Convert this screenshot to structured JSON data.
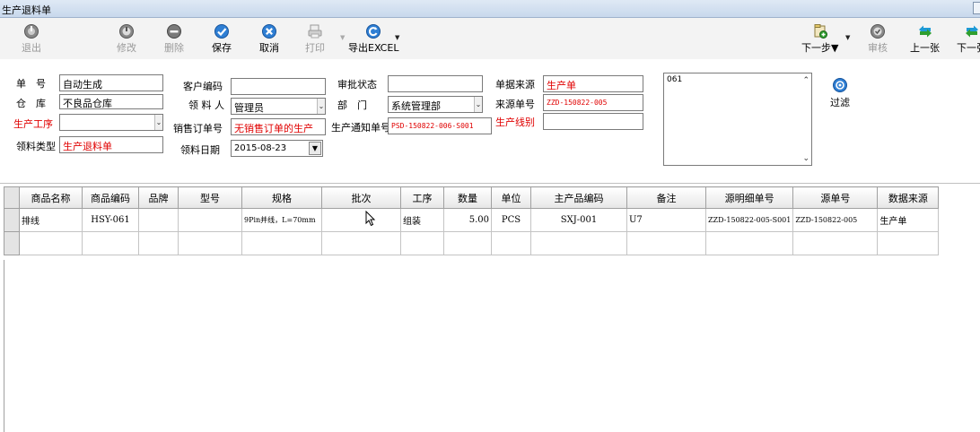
{
  "window": {
    "title": "生产退料单"
  },
  "toolbar": {
    "exit": "退出",
    "edit": "修改",
    "delete": "删除",
    "save": "保存",
    "cancel": "取消",
    "print": "打印",
    "export": "导出EXCEL",
    "next_step": "下一步▼",
    "audit": "审核",
    "prev": "上一张",
    "next": "下一张"
  },
  "form": {
    "doc_no": {
      "label": "单　号",
      "value": "自动生成"
    },
    "warehouse": {
      "label": "仓　库",
      "value": "不良品仓库"
    },
    "process": {
      "label": "生产工序",
      "value": ""
    },
    "pick_type": {
      "label": "领料类型",
      "value": "生产退料单"
    },
    "customer_code": {
      "label": "客户编码",
      "value": ""
    },
    "picker": {
      "label": "领 料 人",
      "value": "管理员"
    },
    "sales_order": {
      "label": "销售订单号",
      "value": "无销售订单的生产"
    },
    "pick_date": {
      "label": "领料日期",
      "value": "2015-08-23"
    },
    "approval": {
      "label": "审批状态",
      "value": ""
    },
    "dept": {
      "label": "部　门",
      "value": "系统管理部"
    },
    "prod_notice": {
      "label": "生产通知单号",
      "value": "PSD-150822-006-S001"
    },
    "doc_source": {
      "label": "单据来源",
      "value": "生产单"
    },
    "source_no": {
      "label": "来源单号",
      "value": "ZZD-150822-005"
    },
    "prod_line": {
      "label": "生产线别",
      "value": ""
    },
    "memo": "061",
    "filter_label": "过滤"
  },
  "grid": {
    "columns": [
      "商品名称",
      "商品编码",
      "品牌",
      "型号",
      "规格",
      "批次",
      "工序",
      "数量",
      "单位",
      "主产品编码",
      "备注",
      "源明细单号",
      "源单号",
      "数据来源"
    ],
    "rows": [
      [
        "排线",
        "HSY-061",
        "",
        "",
        "9Pin并线，L=70mm",
        "",
        "组装",
        "5.00",
        "PCS",
        "SXJ-001",
        "U7",
        "ZZD-150822-005-S001",
        "ZZD-150822-005",
        "生产单"
      ]
    ]
  },
  "colors": {
    "required_label": "#e00000",
    "title_bg": "#c8d8ec",
    "toolbar_bg": "#f3f3f3"
  }
}
